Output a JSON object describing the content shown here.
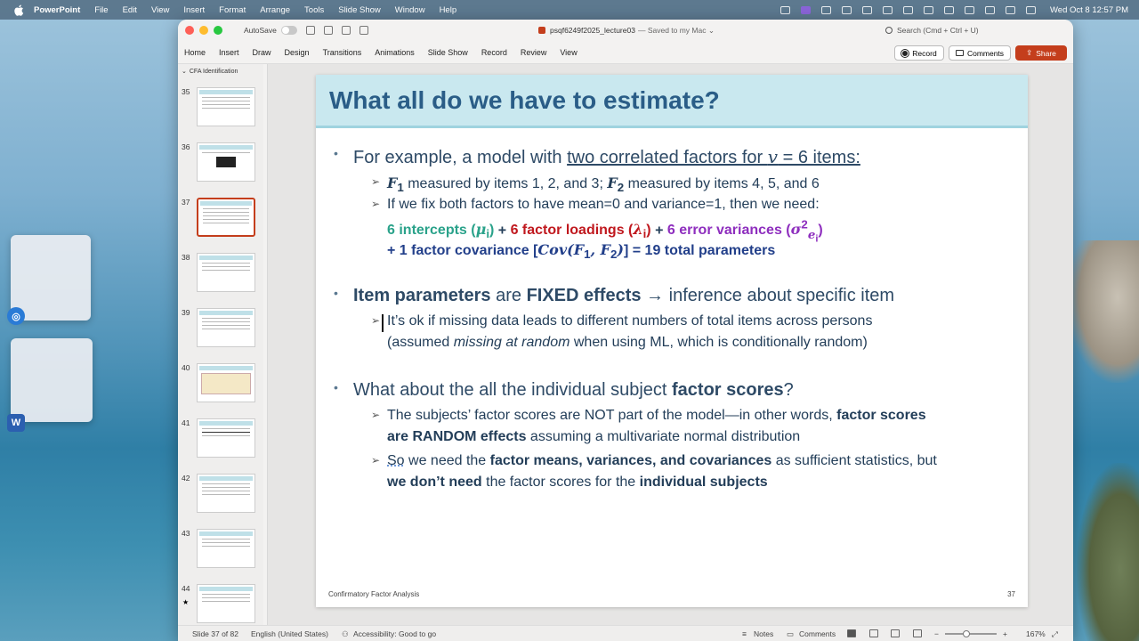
{
  "menubar": {
    "app_name": "PowerPoint",
    "items": [
      "File",
      "Edit",
      "View",
      "Insert",
      "Format",
      "Arrange",
      "Tools",
      "Slide Show",
      "Window",
      "Help"
    ],
    "clock": "Wed Oct 8  12:57 PM"
  },
  "window": {
    "autosave_label": "AutoSave",
    "doc_title": "psqf6249f2025_lecture03",
    "doc_subtitle": "— Saved to my Mac ⌄",
    "search_placeholder": "Search (Cmd + Ctrl + U)"
  },
  "ribbon": {
    "tabs": [
      "Home",
      "Insert",
      "Draw",
      "Design",
      "Transitions",
      "Animations",
      "Slide Show",
      "Record",
      "Review",
      "View"
    ],
    "record_label": "Record",
    "comments_label": "Comments",
    "share_label": "Share"
  },
  "thumbnails": {
    "section_label": "CFA Identification",
    "slides": [
      "35",
      "36",
      "37",
      "38",
      "39",
      "40",
      "41",
      "42",
      "43",
      "44"
    ],
    "selected": "37"
  },
  "slide": {
    "title": "What all do we have to estimate?",
    "b1": {
      "pre": "For example, a model with ",
      "underlined": "two correlated factors for ",
      "math": "v",
      "eq": " = 6 items:"
    },
    "b1a": {
      "f1": "F",
      "s1": "1",
      "t1": " measured by items 1, 2, and 3; ",
      "f2": "F",
      "s2": "2",
      "t2": " measured by items 4, 5, and 6"
    },
    "b1b": {
      "line1": "If we fix both factors to have mean=0 and variance=1, then we need:",
      "intercepts": "6 intercepts (",
      "mu": "μ",
      "mu_sub": "i",
      "intercepts_close": ")",
      "plus1": " + ",
      "loadings": "6 factor loadings (",
      "lambda": "λ",
      "lambda_sub": "i",
      "loadings_close": ")",
      "plus2": " + ",
      "errors": "6 error variances (",
      "sigma": "σ",
      "sigma_sup": "2",
      "sigma_sub": "e",
      "sigma_subsub": "i",
      "errors_close": ")",
      "line3_pre": "+ 1 factor covariance [",
      "cov": "Cov",
      "cov_args": "(F",
      "cov_s1": "1",
      "cov_mid": ", F",
      "cov_s2": "2",
      "cov_close": ")",
      "line3_post": "] = 19 total parameters"
    },
    "b2": {
      "bold1": "Item parameters",
      "t1": " are ",
      "bold2": "FIXED effects",
      "arrow": " → ",
      "t2": "inference about specific item"
    },
    "b2a": {
      "line1": "It’s ok if missing data leads to different numbers of total items across persons",
      "line2_pre": "(assumed ",
      "line2_it": "missing at random",
      "line2_post": " when using ML, which is conditionally random)"
    },
    "b3": {
      "t1": "What about the all the individual subject ",
      "bold": "factor scores",
      "t2": "?"
    },
    "b3a": {
      "line1_pre": "The subjects’ factor scores are NOT part of the model—in other words, ",
      "line1_bold": "factor scores",
      "line2_bold": "are RANDOM effects",
      "line2_post": " assuming a multivariate normal distribution"
    },
    "b3b": {
      "line1_pre": "So",
      "line1_mid": " we need the ",
      "line1_bold": "factor means, variances, and covariances",
      "line1_post": " as sufficient statistics, but",
      "line2_bold1": "we don’t need",
      "line2_mid": " the factor scores for the ",
      "line2_bold2": "individual subjects"
    },
    "footer_left": "Confirmatory Factor Analysis",
    "footer_right": "37"
  },
  "statusbar": {
    "slide_info": "Slide 37 of 82",
    "language": "English (United States)",
    "accessibility": "Accessibility: Good to go",
    "notes": "Notes",
    "comments": "Comments",
    "zoom": "167%"
  }
}
